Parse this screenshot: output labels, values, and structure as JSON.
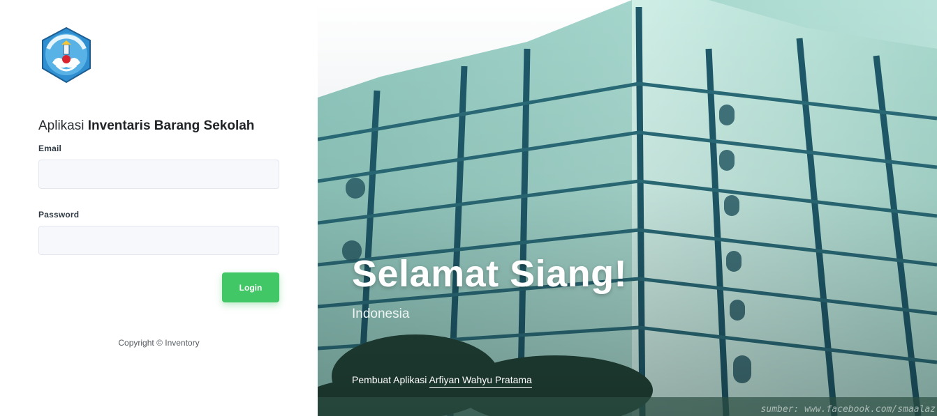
{
  "left": {
    "app_title_prefix": "Aplikasi",
    "app_title_bold": "Inventaris Barang Sekolah",
    "email_label": "Email",
    "email_value": "",
    "password_label": "Password",
    "password_value": "",
    "login_label": "Login",
    "copyright": "Copyright © Inventory"
  },
  "hero": {
    "greeting": "Selamat Siang!",
    "location": "Indonesia",
    "credit_prefix": "Pembuat Aplikasi",
    "credit_name": "Arfiyan Wahyu Pratama",
    "watermark": "sumber: www.facebook.com/smaalaz"
  },
  "colors": {
    "login_button": "#41c765",
    "input_bg": "#f7f8fc"
  },
  "icons": {
    "logo": "tut-wuri-handayani-emblem"
  }
}
